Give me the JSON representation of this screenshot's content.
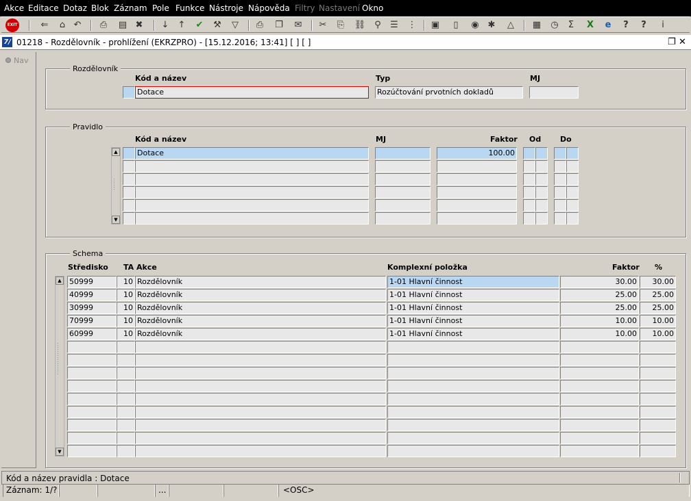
{
  "menu": [
    "Akce",
    "Editace",
    "Dotaz",
    "Blok",
    "Záznam",
    "Pole",
    "Funkce",
    "Nástroje",
    "Nápověda",
    "Filtry",
    "Nastavení",
    "Okno"
  ],
  "menu_disabled": [
    "Filtry",
    "Nastavení"
  ],
  "toolbar": {
    "exit_label": "EXIT",
    "icons": [
      "exit-icon",
      "arrow-back-icon",
      "home-icon",
      "undo-icon",
      "print-icon",
      "print-preview-icon",
      "delete-record-icon",
      "sort-asc-icon",
      "sort-desc-icon",
      "check-icon",
      "wrench-icon",
      "filter-icon",
      "printer-icon",
      "copy-icon",
      "email-icon",
      "scissors-icon",
      "paste-icon",
      "link-icon",
      "attach-icon",
      "outline-icon",
      "tree-icon",
      "clipboard-icon",
      "document-icon",
      "globe-icon",
      "settings-icon",
      "chart-icon",
      "calendar-icon",
      "clock-icon",
      "sigma-icon",
      "excel-icon",
      "browser-icon",
      "folder-help-icon",
      "help-icon",
      "info-icon"
    ]
  },
  "window": {
    "logo": "7/",
    "title": "01218 - Rozdělovník - prohlížení (EKRZPRO) - [15.12.2016; 13:41]  [ ]  [ ]",
    "restore": "❐",
    "close": "✕"
  },
  "nav": {
    "label": "Nav"
  },
  "rozdelovnik": {
    "title": "Rozdělovník",
    "h_kod": "Kód a název",
    "h_typ": "Typ",
    "h_mj": "MJ",
    "kod": "Dotace",
    "typ": "Rozúčtování prvotních dokladů",
    "mj": ""
  },
  "pravidlo": {
    "title": "Pravidlo",
    "h_kod": "Kód a název",
    "h_mj": "MJ",
    "h_faktor": "Faktor",
    "h_od": "Od",
    "h_do": "Do",
    "rows": [
      {
        "kod": "Dotace",
        "mj": "",
        "faktor": "100.00"
      },
      {
        "kod": "",
        "mj": "",
        "faktor": ""
      },
      {
        "kod": "",
        "mj": "",
        "faktor": ""
      },
      {
        "kod": "",
        "mj": "",
        "faktor": ""
      },
      {
        "kod": "",
        "mj": "",
        "faktor": ""
      },
      {
        "kod": "",
        "mj": "",
        "faktor": ""
      }
    ]
  },
  "schema": {
    "title": "Schema",
    "h_stredisko": "Středisko",
    "h_ta": "TA",
    "h_akce": "Akce",
    "h_komplex": "Komplexní položka",
    "h_faktor": "Faktor",
    "h_pct": "%",
    "rows": [
      {
        "stredisko": "50999",
        "ta": "10",
        "akce": "Rozdělovník",
        "komplex": "1-01 Hlavní činnost",
        "faktor": "30.00",
        "pct": "30.00"
      },
      {
        "stredisko": "40999",
        "ta": "10",
        "akce": "Rozdělovník",
        "komplex": "1-01 Hlavní činnost",
        "faktor": "25.00",
        "pct": "25.00"
      },
      {
        "stredisko": "30999",
        "ta": "10",
        "akce": "Rozdělovník",
        "komplex": "1-01 Hlavní činnost",
        "faktor": "25.00",
        "pct": "25.00"
      },
      {
        "stredisko": "70999",
        "ta": "10",
        "akce": "Rozdělovník",
        "komplex": "1-01 Hlavní činnost",
        "faktor": "10.00",
        "pct": "10.00"
      },
      {
        "stredisko": "60999",
        "ta": "10",
        "akce": "Rozdělovník",
        "komplex": "1-01 Hlavní činnost",
        "faktor": "10.00",
        "pct": "10.00"
      },
      {
        "stredisko": "",
        "ta": "",
        "akce": "",
        "komplex": "",
        "faktor": "",
        "pct": ""
      },
      {
        "stredisko": "",
        "ta": "",
        "akce": "",
        "komplex": "",
        "faktor": "",
        "pct": ""
      },
      {
        "stredisko": "",
        "ta": "",
        "akce": "",
        "komplex": "",
        "faktor": "",
        "pct": ""
      },
      {
        "stredisko": "",
        "ta": "",
        "akce": "",
        "komplex": "",
        "faktor": "",
        "pct": ""
      },
      {
        "stredisko": "",
        "ta": "",
        "akce": "",
        "komplex": "",
        "faktor": "",
        "pct": ""
      },
      {
        "stredisko": "",
        "ta": "",
        "akce": "",
        "komplex": "",
        "faktor": "",
        "pct": ""
      },
      {
        "stredisko": "",
        "ta": "",
        "akce": "",
        "komplex": "",
        "faktor": "",
        "pct": ""
      },
      {
        "stredisko": "",
        "ta": "",
        "akce": "",
        "komplex": "",
        "faktor": "",
        "pct": ""
      },
      {
        "stredisko": "",
        "ta": "",
        "akce": "",
        "komplex": "",
        "faktor": "",
        "pct": ""
      }
    ]
  },
  "status": {
    "hint": "Kód a název pravidla : Dotace",
    "record": "Záznam: 1/?",
    "ellipsis": "...",
    "mode": "<OSC>"
  }
}
